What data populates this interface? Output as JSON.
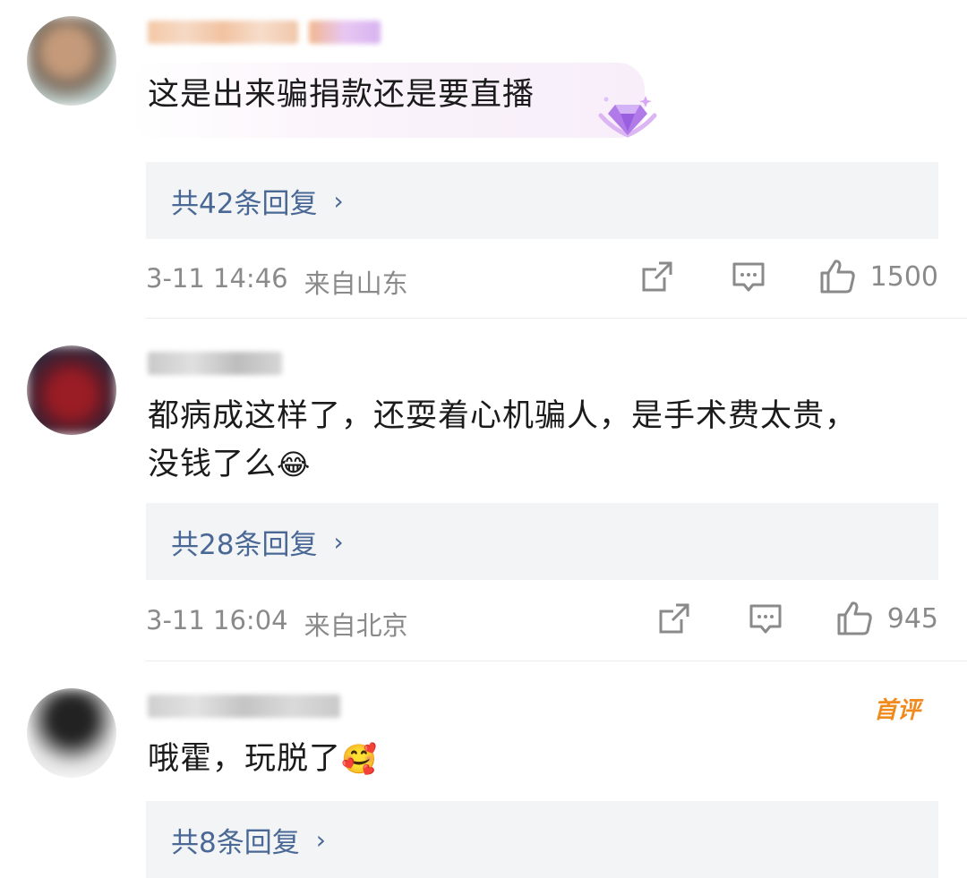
{
  "comments": [
    {
      "text": "这是出来骗捐款还是要直播",
      "replies_label": "共42条回复",
      "time": "3-11 14:46",
      "location": "来自山东",
      "likes": "1500"
    },
    {
      "text_line1": "都病成这样了，还耍着心机骗人，是手术费太贵，",
      "text_line2": "没钱了么",
      "emoji": "😂",
      "replies_label": "共28条回复",
      "time": "3-11 16:04",
      "location": "来自北京",
      "likes": "945"
    },
    {
      "text": "哦霍，玩脱了",
      "emoji": "🥰",
      "badge": "首评",
      "replies_label": "共8条回复"
    }
  ],
  "icons": {
    "chevron": "›",
    "share": "share-icon",
    "comment": "comment-icon",
    "like": "thumbs-up-icon",
    "gem": "gem-badge-icon"
  },
  "colors": {
    "reply_link": "#4a6895",
    "meta_text": "#8a8a8a",
    "reply_bg": "#f3f4f6",
    "badge": "#f08a1c",
    "gem": "#b07ae8"
  }
}
